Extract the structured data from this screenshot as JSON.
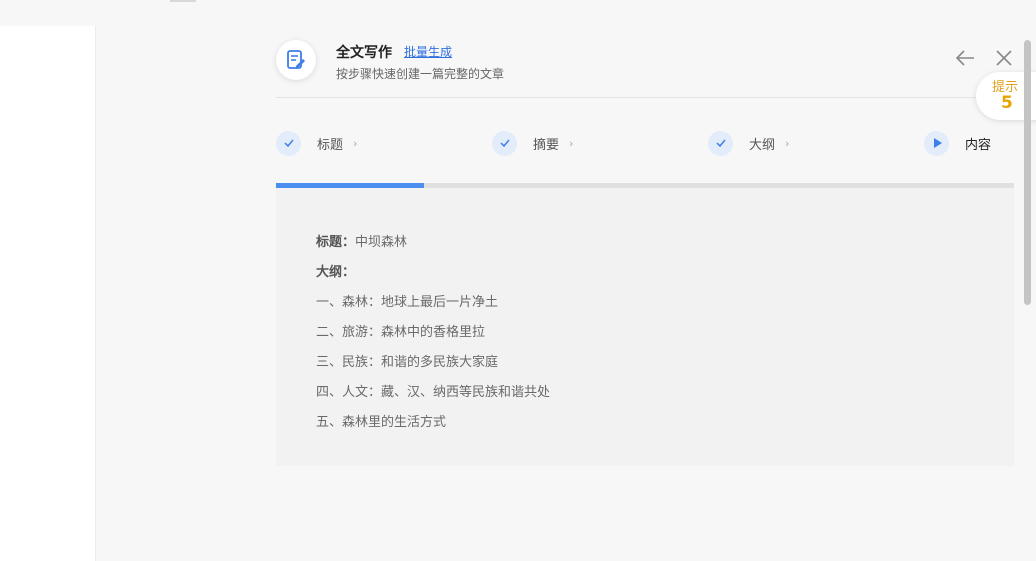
{
  "header": {
    "title": "全文写作",
    "batch_link": "批量生成",
    "subtitle": "按步骤快速创建一篇完整的文章",
    "icons": [
      "edit-document-icon",
      "arrow-left-icon",
      "close-icon"
    ]
  },
  "steps": [
    {
      "label": "标题",
      "state": "done",
      "icon": "check-icon"
    },
    {
      "label": "摘要",
      "state": "done",
      "icon": "check-icon"
    },
    {
      "label": "大纲",
      "state": "done",
      "icon": "check-icon"
    },
    {
      "label": "内容",
      "state": "active",
      "icon": "play-icon"
    }
  ],
  "progress": {
    "fraction": 0.2
  },
  "content": {
    "title_label": "标题：",
    "title_value": "中坝森林",
    "outline_label": "大纲：",
    "outline": [
      "一、森林：地球上最后一片净土",
      "二、旅游：森林中的香格里拉",
      "三、民族：和谐的多民族大家庭",
      "四、人文：藏、汉、纳西等民族和谐共处",
      "五、森林里的生活方式"
    ]
  },
  "hint": {
    "label": "提示",
    "count": "5"
  },
  "colors": {
    "accent": "#4a8ff0",
    "link": "#2f6fe0",
    "hint": "#e8a400",
    "step_bg": "#e3ecfb"
  }
}
